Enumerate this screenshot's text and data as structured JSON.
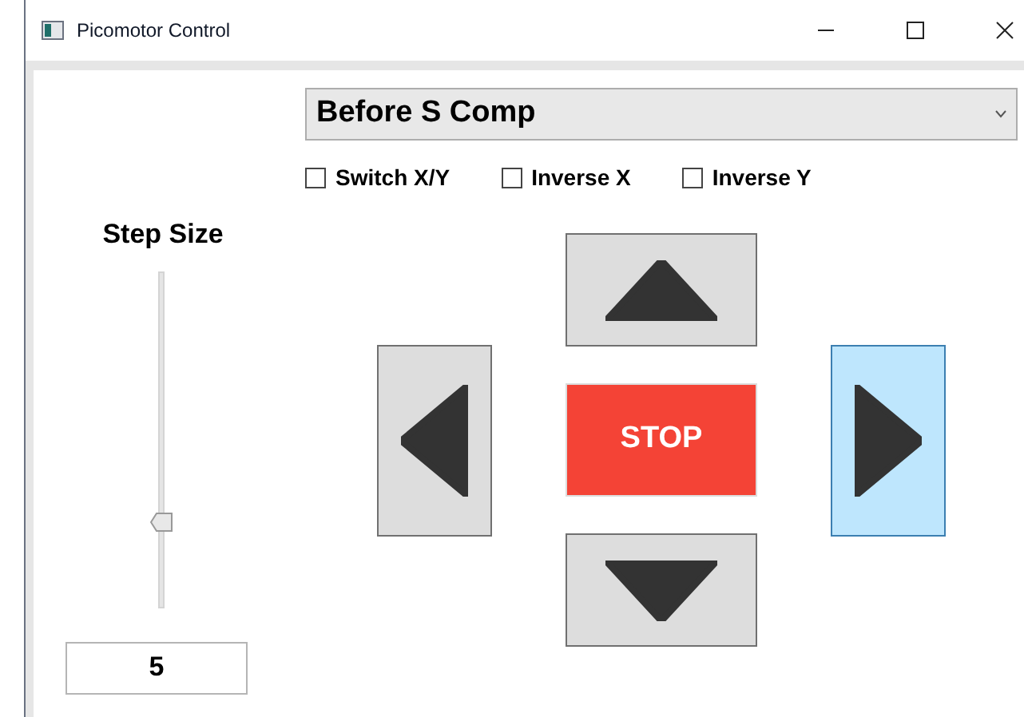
{
  "window": {
    "title": "Picomotor Control"
  },
  "preset": {
    "value": "Before S Comp"
  },
  "options": [
    {
      "label": "Switch X/Y",
      "checked": false
    },
    {
      "label": "Inverse X",
      "checked": false
    },
    {
      "label": "Inverse Y",
      "checked": false
    }
  ],
  "step_size": {
    "label": "Step Size",
    "level": 0.24,
    "value": "5"
  },
  "pad": [
    {
      "kind": "up",
      "highlighted": false
    },
    {
      "kind": "left",
      "highlighted": false
    },
    {
      "kind": "stop",
      "label": "STOP",
      "highlighted": false
    },
    {
      "kind": "right",
      "highlighted": true
    },
    {
      "kind": "down",
      "highlighted": false
    }
  ]
}
